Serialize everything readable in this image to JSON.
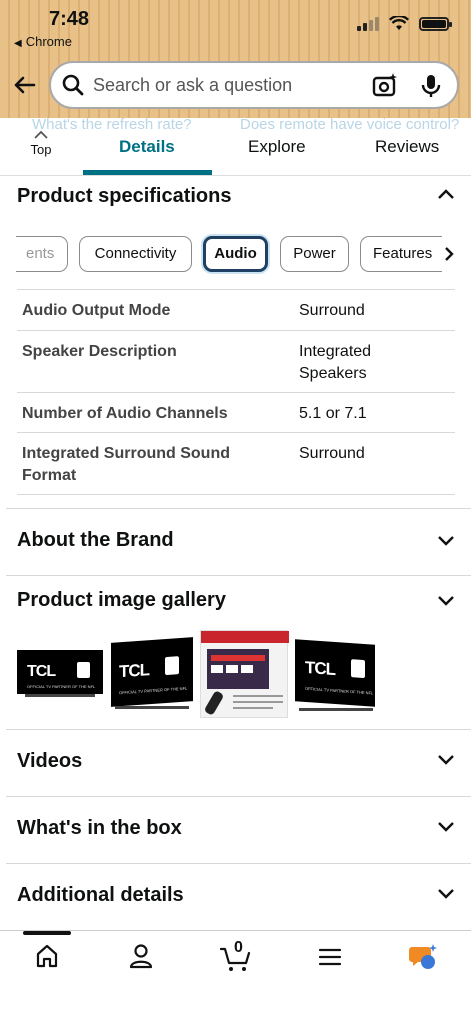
{
  "status_bar": {
    "time": "7:48",
    "back_app": "Chrome"
  },
  "search": {
    "placeholder": "Search or ask a question"
  },
  "suggestions": [
    "What's the refresh rate?",
    "Does remote have voice control?"
  ],
  "tabs": {
    "top_label": "Top",
    "items": [
      "Details",
      "Explore",
      "Reviews"
    ],
    "active": "Details"
  },
  "product_specs": {
    "title": "Product specifications",
    "chips": [
      "ents",
      "Connectivity",
      "Audio",
      "Power",
      "Features"
    ],
    "active_chip": "Audio",
    "rows": [
      {
        "key": "Audio Output Mode",
        "value": "Surround"
      },
      {
        "key": "Speaker Description",
        "value": "Integrated Speakers"
      },
      {
        "key": "Number of Audio Channels",
        "value": "5.1 or 7.1"
      },
      {
        "key": "Integrated Surround Sound Format",
        "value": "Surround"
      }
    ]
  },
  "sections": {
    "about_brand": "About the Brand",
    "gallery": "Product image gallery",
    "videos": "Videos",
    "in_box": "What's in the box",
    "additional": "Additional details"
  },
  "gallery_images": {
    "brand_text": "TCL",
    "tagline": "OFFICIAL TV PARTNER OF THE NFL"
  },
  "bottom_nav": {
    "cart_count": "0"
  },
  "colors": {
    "accent": "#007185",
    "header_bg": "#e8c188",
    "chip_active_border": "#1f3f63",
    "alexa_orange": "#f08a24",
    "alexa_blue": "#3a78d8"
  }
}
